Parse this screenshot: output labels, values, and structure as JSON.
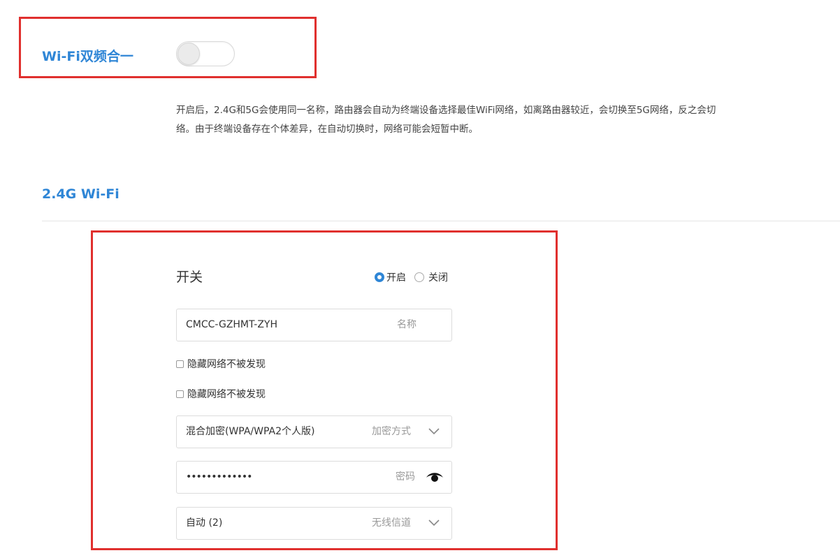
{
  "dual_band": {
    "label": "Wi-Fi双频合一",
    "enabled": false,
    "description_line1": "开启后，2.4G和5G会使用同一名称，路由器会自动为终端设备选择最佳WiFi网络，如离路由器较近，会切换至5G网络，反之会切",
    "description_line2": "络。由于终端设备存在个体差异，在自动切换时，网络可能会短暂中断。"
  },
  "section_24g": {
    "title": "2.4G Wi-Fi",
    "switch": {
      "label": "开关",
      "options": [
        "开启",
        "关闭"
      ],
      "selected": "开启"
    },
    "ssid": {
      "value": "CMCC-GZHMT-ZYH",
      "hint": "名称"
    },
    "checkboxes": [
      {
        "label": "隐藏网络不被发现",
        "checked": false
      },
      {
        "label": "隐藏网络不被发现",
        "checked": false
      }
    ],
    "encryption": {
      "value": "混合加密(WPA/WPA2个人版)",
      "hint": "加密方式"
    },
    "password": {
      "value": "•••••••••••••",
      "hint": "密码"
    },
    "channel": {
      "value": "自动 (2)",
      "hint": "无线信道"
    }
  },
  "icons": {
    "eye": "eye-icon",
    "dropdown": "chevron-down-icon"
  },
  "colors": {
    "accent_blue": "#2f86d6",
    "highlight_red": "#e0302e"
  }
}
